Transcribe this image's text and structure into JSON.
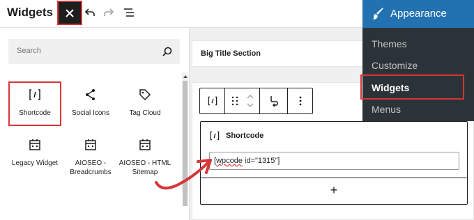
{
  "topbar": {
    "title": "Widgets",
    "close_icon": "close-icon",
    "undo_icon": "undo-icon",
    "redo_icon": "redo-icon",
    "list_view_icon": "list-view-icon"
  },
  "inserter": {
    "search_placeholder": "Search",
    "blocks": [
      {
        "label": "Shortcode",
        "icon": "shortcode-icon"
      },
      {
        "label": "Social Icons",
        "icon": "share-icon"
      },
      {
        "label": "Tag Cloud",
        "icon": "tag-icon"
      },
      {
        "label": "Legacy Widget",
        "icon": "calendar-icon"
      },
      {
        "label": "AIOSEO - Breadcrumbs",
        "icon": "calendar-icon"
      },
      {
        "label": "AIOSEO - HTML Sitemap",
        "icon": "calendar-icon"
      }
    ]
  },
  "editor": {
    "section_title": "Big Title Section",
    "shortcode_block": {
      "title": "Shortcode",
      "value_prefix": "[",
      "value_wavy": "wpcode",
      "value_suffix": " id=\"1315\"]",
      "add_label": "+"
    }
  },
  "appearance_menu": {
    "title": "Appearance",
    "items": [
      "Themes",
      "Customize",
      "Widgets",
      "Menus"
    ],
    "current": "Widgets"
  },
  "colors": {
    "highlight": "#d63638",
    "wp_blue": "#2271b1",
    "admin_menu_bg": "#2c3338"
  }
}
